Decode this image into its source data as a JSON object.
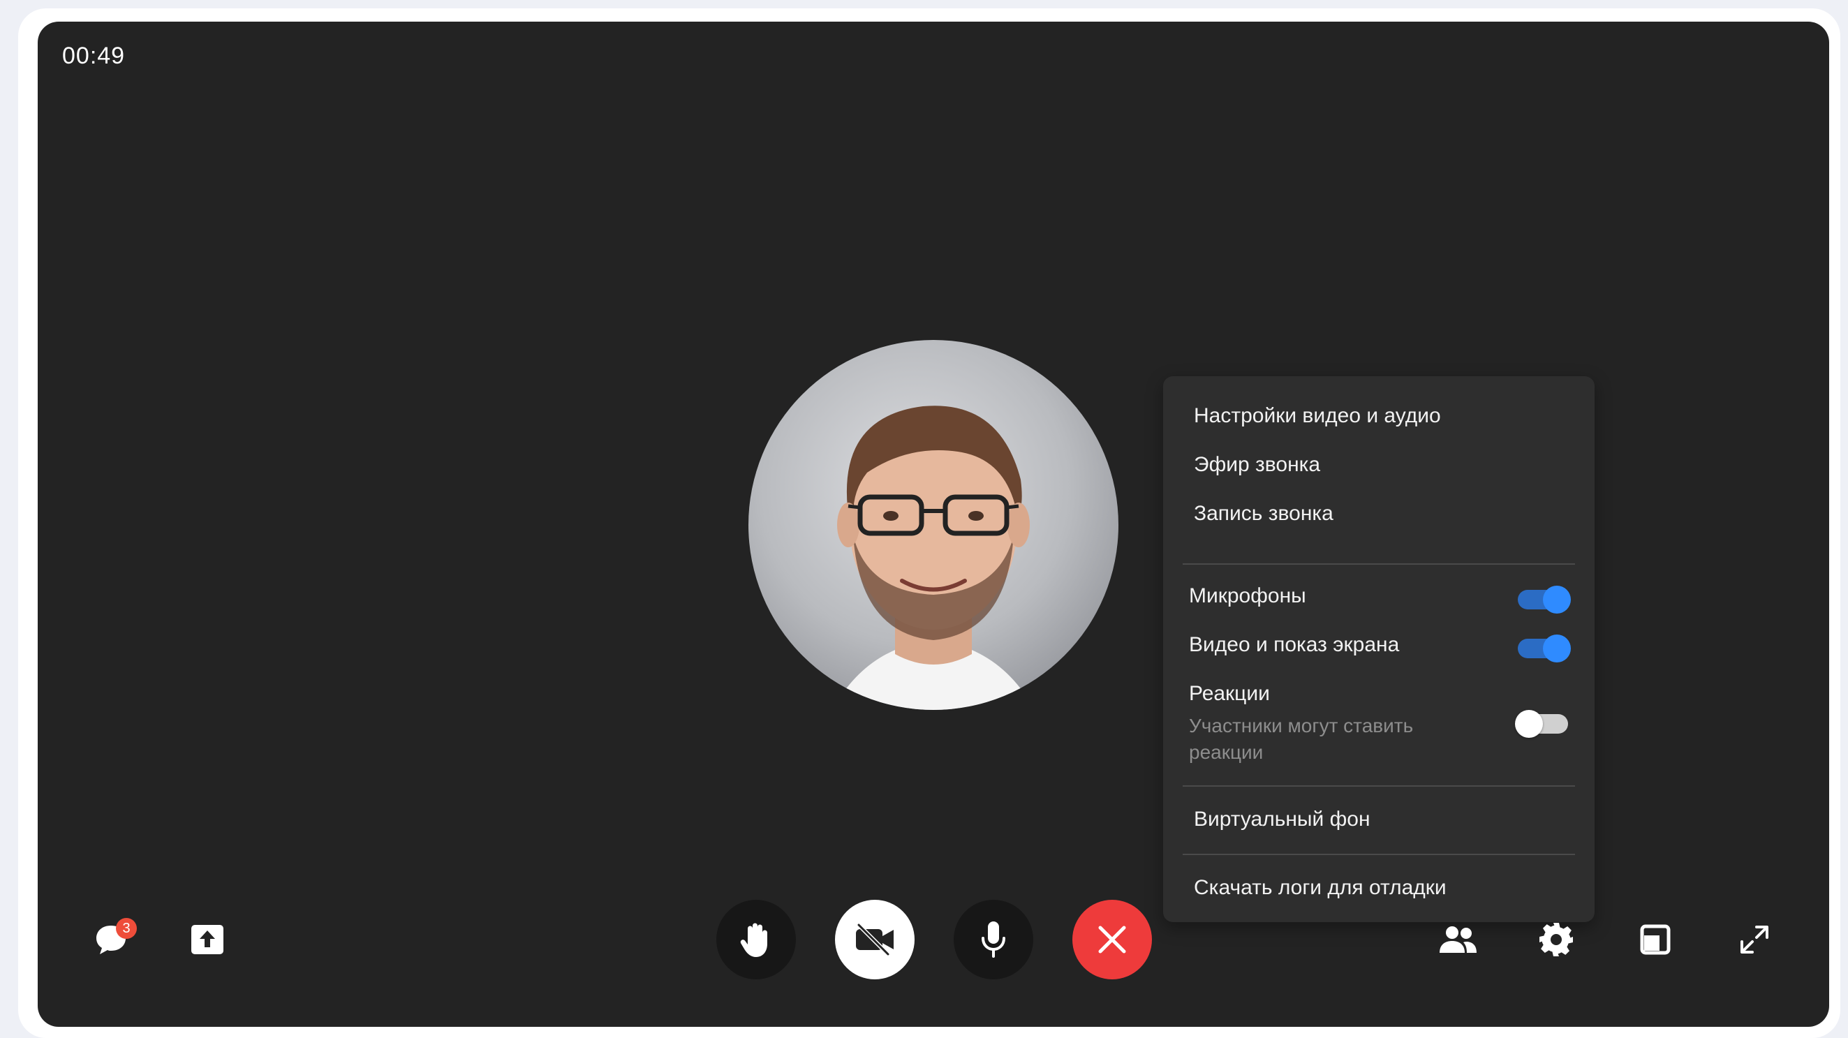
{
  "call": {
    "timer": "00:49"
  },
  "settings_menu": {
    "items_top": [
      {
        "label": "Настройки видео и аудио"
      },
      {
        "label": "Эфир звонка"
      },
      {
        "label": "Запись звонка"
      }
    ],
    "toggles": [
      {
        "label": "Микрофоны",
        "enabled": true
      },
      {
        "label": "Видео и показ экрана",
        "enabled": true
      },
      {
        "label": "Реакции",
        "sublabel": "Участники могут ставить реакции",
        "enabled": false
      }
    ],
    "virtual_background": "Виртуальный фон",
    "download_logs": "Скачать логи для отладки"
  },
  "toolbar": {
    "chat_badge": "3",
    "left_icons": [
      "chat-icon",
      "share-screen-icon"
    ],
    "center_buttons": [
      "raise-hand-icon",
      "camera-off-icon",
      "microphone-icon",
      "end-call-icon"
    ],
    "right_icons": [
      "participants-icon",
      "gear-icon",
      "layout-icon",
      "fullscreen-icon"
    ]
  },
  "colors": {
    "background": "#232323",
    "menu_background": "#2e2e2e",
    "toggle_on": "#2f8bff",
    "end_call": "#ee3b3b",
    "badge": "#ee4d3a"
  }
}
